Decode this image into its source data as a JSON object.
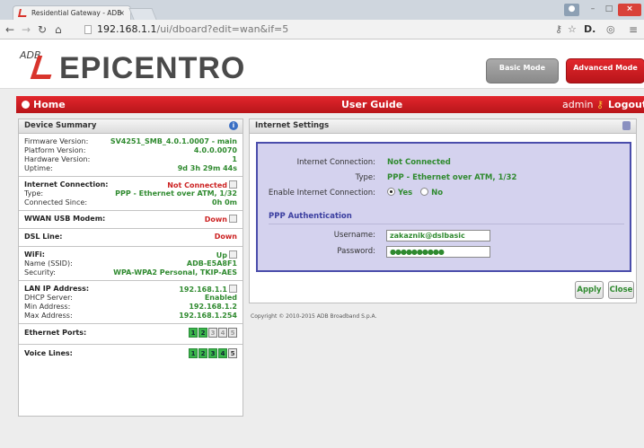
{
  "browser": {
    "tab_title": "Residential Gateway - ADB",
    "tab_close": "×",
    "url_host": "192.168.1.1",
    "url_path": "/ui/dboard?edit=wan&if=5"
  },
  "header": {
    "logo_prefix": "ADB",
    "logo_text": "EPICENTRO",
    "basic_mode_label": "Basic Mode",
    "advanced_mode_label": "Advanced Mode"
  },
  "navbar": {
    "home": "Home",
    "user_guide": "User Guide",
    "admin": "admin",
    "logout": "Logout"
  },
  "device_summary": {
    "title": "Device Summary",
    "firmware_label": "Firmware Version:",
    "firmware_value": "SV4251_SMB_4.0.1.0007 - main",
    "platform_label": "Platform Version:",
    "platform_value": "4.0.0.0070",
    "hardware_label": "Hardware Version:",
    "hardware_value": "1",
    "uptime_label": "Uptime:",
    "uptime_value": "9d 3h 29m 44s",
    "inet_label": "Internet Connection:",
    "inet_value": "Not Connected",
    "type_label": "Type:",
    "type_value": "PPP - Ethernet over ATM, 1/32",
    "connected_since_label": "Connected Since:",
    "connected_since_value": "0h 0m",
    "wwan_label": "WWAN USB Modem:",
    "wwan_value": "Down",
    "dsl_label": "DSL Line:",
    "dsl_value": "Down",
    "wifi_label": "WiFi:",
    "wifi_value": "Up",
    "ssid_label": "Name (SSID):",
    "ssid_value": "ADB-E5A8F1",
    "security_label": "Security:",
    "security_value": "WPA-WPA2 Personal, TKIP-AES",
    "lan_label": "LAN IP Address:",
    "lan_value": "192.168.1.1",
    "dhcp_label": "DHCP Server:",
    "dhcp_value": "Enabled",
    "min_label": "Min Address:",
    "min_value": "192.168.1.2",
    "max_label": "Max Address:",
    "max_value": "192.168.1.254",
    "eth_label": "Ethernet Ports:",
    "eth_ports": [
      "1",
      "2",
      "3",
      "4",
      "5"
    ],
    "voice_label": "Voice Lines:",
    "voice_ports": [
      "1",
      "2",
      "3",
      "4",
      "5"
    ]
  },
  "internet_settings": {
    "title": "Internet Settings",
    "conn_label": "Internet Connection:",
    "conn_value": "Not Connected",
    "type_label": "Type:",
    "type_value": "PPP - Ethernet over ATM, 1/32",
    "enable_label": "Enable Internet Connection:",
    "yes_label": "Yes",
    "no_label": "No",
    "ppp_title": "PPP Authentication",
    "username_label": "Username:",
    "username_value": "zakaznik@dslbasic",
    "password_label": "Password:",
    "password_value": "●●●●●●●●●●",
    "apply_label": "Apply",
    "close_label": "Close"
  },
  "footer": {
    "copyright": "Copyright © 2010-2015 ADB Broadband S.p.A."
  },
  "colors": {
    "accent_red": "#d8342c",
    "value_green": "#2f8a2f",
    "form_border": "#4a4dab"
  }
}
